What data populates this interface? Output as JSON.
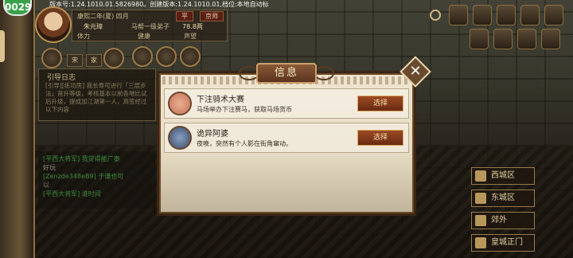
{
  "top": {
    "badge": "0029",
    "version_text": "版本号:1.24.1010.01.5826980。创建版本:1.24.1010.01,档位:本地自动标"
  },
  "player": {
    "date": "康熙二年(夏) 四月",
    "location_tag": "平",
    "city": "京师",
    "name": "朱元璋",
    "title": "马帮一级弟子",
    "money": "78.8两",
    "hp_label": "体力",
    "hp_extra": "健康",
    "extra": "声望"
  },
  "quick_tabs": [
    "宋",
    "家"
  ],
  "log": {
    "title": "引导日志",
    "text": "[引导][练功房] 我长寿可进行「三层步法」首升等级，考核基本以前各地比试后升级，提成加江湖第一人，高签经过以下内容"
  },
  "chat": [
    {
      "channel": "[平西大将军]",
      "text": "我觉得能广泰",
      "color": "#3e8a3a"
    },
    {
      "channel": "",
      "text": "好玩",
      "color": "#8a8a7a"
    },
    {
      "channel": "[Zenzde348eB9]",
      "text": "于谦也可",
      "color": "#3e8a3a"
    },
    {
      "channel": "",
      "text": "以",
      "color": "#8a8a7a"
    },
    {
      "channel": "[平西大将军]",
      "text": "谁时间",
      "color": "#3e8a3a"
    }
  ],
  "districts": [
    "西城区",
    "东城区",
    "郊外",
    "皇城正门"
  ],
  "dialog": {
    "title": "信息",
    "close_label": "✕",
    "events": [
      {
        "title": "下注骑术大赛",
        "desc": "马场举办下注赛马，获取马场货币",
        "button": "选择",
        "icon_color": "#c8705a"
      },
      {
        "title": "诡异阿婆",
        "desc": "夜晚，突然有个人影在街角窜动。",
        "button": "选择",
        "icon_color": "#3a4a6a"
      }
    ]
  }
}
